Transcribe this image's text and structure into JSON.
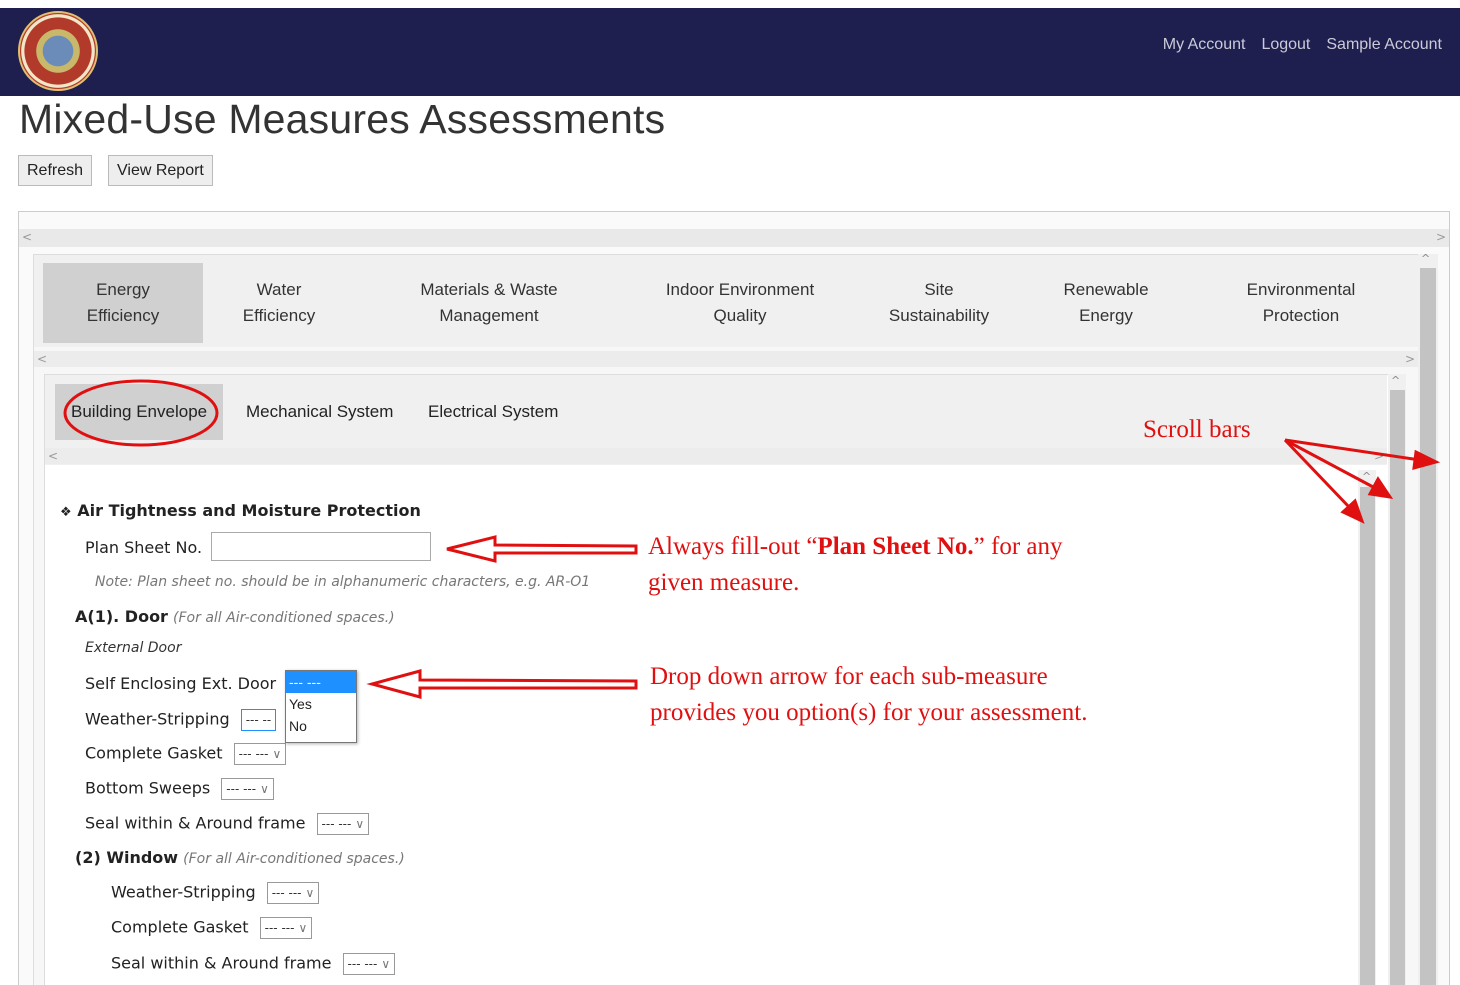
{
  "nav": {
    "my_account": "My Account",
    "logout": "Logout",
    "sample_account": "Sample Account"
  },
  "page_title": "Mixed-Use Measures Assessments",
  "toolbar": {
    "refresh": "Refresh",
    "view_report": "View Report"
  },
  "main_tabs": [
    {
      "line1": "Energy",
      "line2": "Efficiency"
    },
    {
      "line1": "Water",
      "line2": "Efficiency"
    },
    {
      "line1": "Materials & Waste",
      "line2": "Management"
    },
    {
      "line1": "Indoor Environment",
      "line2": "Quality"
    },
    {
      "line1": "Site",
      "line2": "Sustainability"
    },
    {
      "line1": "Renewable",
      "line2": "Energy"
    },
    {
      "line1": "Environmental",
      "line2": "Protection"
    }
  ],
  "sub_tabs": [
    "Building Envelope",
    "Mechanical System",
    "Electrical System"
  ],
  "form": {
    "section_title": "Air Tightness and Moisture Protection",
    "plan_sheet_label": "Plan Sheet No.",
    "plan_sheet_value": "",
    "plan_sheet_note": "Note: Plan sheet no. should be in alphanumeric characters, e.g. AR-O1",
    "door_heading": "A(1). Door",
    "door_hint": "(For all Air-conditioned spaces.)",
    "external_door": "External Door",
    "self_enclosing": "Self Enclosing Ext. Door",
    "weather_stripping": "Weather-Stripping",
    "complete_gasket": "Complete Gasket",
    "bottom_sweeps": "Bottom Sweeps",
    "seal_frame": "Seal within & Around frame",
    "window_heading": "(2) Window",
    "window_hint": "(For all Air-conditioned spaces.)",
    "win_weather_stripping": "Weather-Stripping",
    "win_complete_gasket": "Complete Gasket",
    "win_seal_frame": "Seal within & Around frame",
    "select_placeholder": "--- ---",
    "select_partial": "--- --"
  },
  "dropdown_options": [
    "--- ---",
    "Yes",
    "No"
  ],
  "annotations": {
    "scroll_bars": "Scroll bars",
    "plan_sheet_pre": "Always fill-out “",
    "plan_sheet_bold": "Plan Sheet No.",
    "plan_sheet_post": "” for any",
    "plan_sheet_line2": "given measure.",
    "dropdown_line1": "Drop down arrow for each sub-measure",
    "dropdown_line2": "provides you option(s) for your assessment."
  },
  "colors": {
    "navbar": "#1f1f4f",
    "annotation_red": "#e01010",
    "dropdown_highlight": "#1e90ff"
  }
}
